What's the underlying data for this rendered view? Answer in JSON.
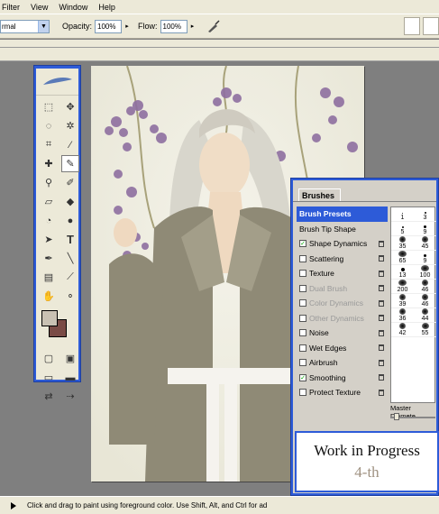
{
  "menu": {
    "items": [
      "Filter",
      "View",
      "Window",
      "Help"
    ]
  },
  "options_bar": {
    "mode_value": "rmal",
    "opacity_label": "Opacity:",
    "opacity_value": "100%",
    "flow_label": "Flow:",
    "flow_value": "100%"
  },
  "brushes_palette": {
    "tab_label": "Brushes",
    "items": [
      {
        "label": "Brush Presets",
        "highlighted": true,
        "checkbox": false,
        "checked": false,
        "dimmed": false,
        "lock": false
      },
      {
        "label": "Brush Tip Shape",
        "highlighted": false,
        "checkbox": false,
        "checked": false,
        "dimmed": false,
        "lock": false
      },
      {
        "label": "Shape Dynamics",
        "highlighted": false,
        "checkbox": true,
        "checked": true,
        "dimmed": false,
        "lock": true
      },
      {
        "label": "Scattering",
        "highlighted": false,
        "checkbox": true,
        "checked": false,
        "dimmed": false,
        "lock": true
      },
      {
        "label": "Texture",
        "highlighted": false,
        "checkbox": true,
        "checked": false,
        "dimmed": false,
        "lock": true
      },
      {
        "label": "Dual Brush",
        "highlighted": false,
        "checkbox": true,
        "checked": false,
        "dimmed": true,
        "lock": true
      },
      {
        "label": "Color Dynamics",
        "highlighted": false,
        "checkbox": true,
        "checked": false,
        "dimmed": true,
        "lock": true
      },
      {
        "label": "Other Dynamics",
        "highlighted": false,
        "checkbox": true,
        "checked": false,
        "dimmed": true,
        "lock": true
      },
      {
        "label": "Noise",
        "highlighted": false,
        "checkbox": true,
        "checked": false,
        "dimmed": false,
        "lock": true
      },
      {
        "label": "Wet Edges",
        "highlighted": false,
        "checkbox": true,
        "checked": false,
        "dimmed": false,
        "lock": true
      },
      {
        "label": "Airbrush",
        "highlighted": false,
        "checkbox": true,
        "checked": false,
        "dimmed": false,
        "lock": true
      },
      {
        "label": "Smoothing",
        "highlighted": false,
        "checkbox": true,
        "checked": true,
        "dimmed": false,
        "lock": true
      },
      {
        "label": "Protect Texture",
        "highlighted": false,
        "checkbox": true,
        "checked": false,
        "dimmed": false,
        "lock": true
      }
    ],
    "preset_sizes": [
      "1",
      "3",
      "5",
      "9",
      "35",
      "45",
      "65",
      "9",
      "13",
      "100",
      "200",
      "46",
      "39",
      "46",
      "36",
      "44",
      "42",
      "55"
    ],
    "master_diameter_label": "Master Diamete"
  },
  "overlay": {
    "line1": "Work in Progress",
    "line2": "4-th"
  },
  "status_bar": {
    "text": "Click and drag to paint using foreground color.  Use Shift, Alt, and Ctrl for ad"
  },
  "colors": {
    "foreground": "#c9c1b3",
    "background": "#7a4b45",
    "palette_blue": "#2d5bd8"
  }
}
